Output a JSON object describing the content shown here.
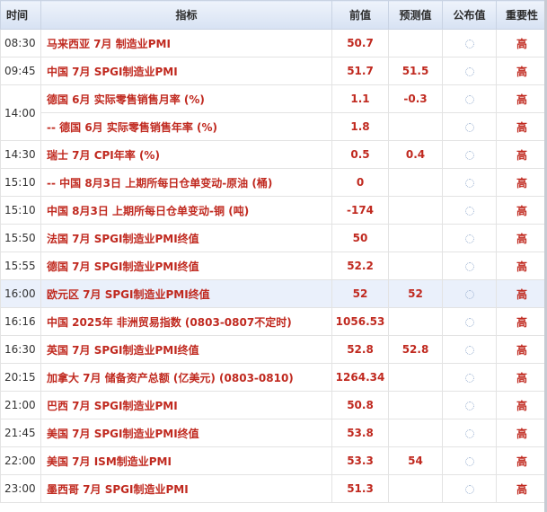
{
  "header": {
    "time": "时间",
    "indicator": "指标",
    "previous": "前值",
    "forecast": "预测值",
    "actual": "公布值",
    "importance": "重要性"
  },
  "rows": [
    {
      "time": "08:30",
      "indicator": "马来西亚 7月 制造业PMI",
      "previous": "50.7",
      "forecast": "",
      "importance": "高"
    },
    {
      "time": "09:45",
      "indicator": "中国 7月 SPGI制造业PMI",
      "previous": "51.7",
      "forecast": "51.5",
      "importance": "高"
    },
    {
      "time": "14:00",
      "indicator": "德国 6月 实际零售销售月率 (%)",
      "previous": "1.1",
      "forecast": "-0.3",
      "importance": "高"
    },
    {
      "time": "",
      "indicator": "-- 德国 6月 实际零售销售年率 (%)",
      "previous": "1.8",
      "forecast": "",
      "importance": "高"
    },
    {
      "time": "14:30",
      "indicator": "瑞士 7月 CPI年率 (%)",
      "previous": "0.5",
      "forecast": "0.4",
      "importance": "高"
    },
    {
      "time": "15:10",
      "indicator": "-- 中国 8月3日 上期所每日仓单变动-原油 (桶)",
      "previous": "0",
      "forecast": "",
      "importance": "高"
    },
    {
      "time": "15:10",
      "indicator": "中国 8月3日 上期所每日仓单变动-铜 (吨)",
      "previous": "-174",
      "forecast": "",
      "importance": "高"
    },
    {
      "time": "15:50",
      "indicator": "法国 7月 SPGI制造业PMI终值",
      "previous": "50",
      "forecast": "",
      "importance": "高"
    },
    {
      "time": "15:55",
      "indicator": "德国 7月 SPGI制造业PMI终值",
      "previous": "52.2",
      "forecast": "",
      "importance": "高"
    },
    {
      "time": "16:00",
      "indicator": "欧元区 7月 SPGI制造业PMI终值",
      "previous": "52",
      "forecast": "52",
      "importance": "高"
    },
    {
      "time": "16:16",
      "indicator": "中国 2025年 非洲贸易指数 (0803-0807不定时)",
      "previous": "1056.53",
      "forecast": "",
      "importance": "高"
    },
    {
      "time": "16:30",
      "indicator": "英国 7月 SPGI制造业PMI终值",
      "previous": "52.8",
      "forecast": "52.8",
      "importance": "高"
    },
    {
      "time": "20:15",
      "indicator": "加拿大 7月 储备资产总额 (亿美元) (0803-0810)",
      "previous": "1264.34",
      "forecast": "",
      "importance": "高"
    },
    {
      "time": "21:00",
      "indicator": "巴西 7月 SPGI制造业PMI",
      "previous": "50.8",
      "forecast": "",
      "importance": "高"
    },
    {
      "time": "21:45",
      "indicator": "美国 7月 SPGI制造业PMI终值",
      "previous": "53.8",
      "forecast": "",
      "importance": "高"
    },
    {
      "time": "22:00",
      "indicator": "美国 7月 ISM制造业PMI",
      "previous": "53.3",
      "forecast": "54",
      "importance": "高"
    },
    {
      "time": "23:00",
      "indicator": "墨西哥 7月 SPGI制造业PMI",
      "previous": "51.3",
      "forecast": "",
      "importance": "高"
    }
  ],
  "icons": {
    "actual_pending": "loading-spinner-icon"
  },
  "colors": {
    "value_text": "#c0291f",
    "header_bg": "#dbe5f4",
    "highlight_row": "#eaf0fb"
  }
}
